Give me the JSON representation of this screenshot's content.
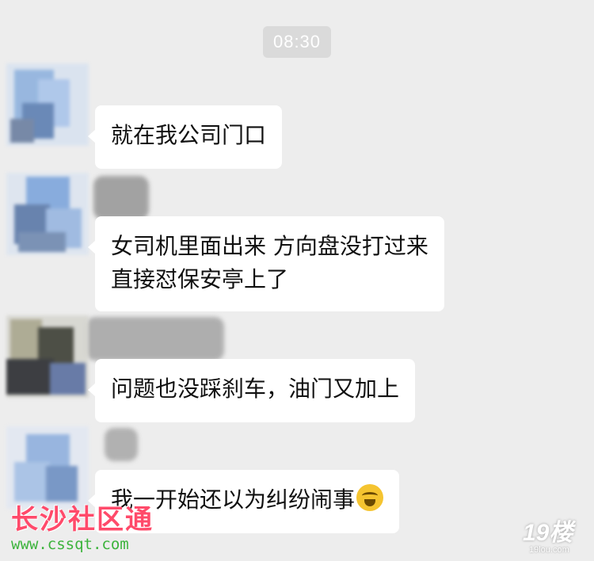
{
  "timestamp": "08:30",
  "messages": [
    {
      "lines": [
        "就在我公司门口"
      ],
      "emoji": ""
    },
    {
      "lines": [
        "女司机里面出来 方向盘没打过来",
        "直接怼保安亭上了"
      ],
      "emoji": ""
    },
    {
      "lines": [
        "问题也没踩刹车，油门又加上"
      ],
      "emoji": ""
    },
    {
      "lines": [
        "我一开始还以为纠纷闹事"
      ],
      "emoji": "face-with-tears-of-joy"
    }
  ],
  "watermarks": {
    "left_title": "长沙社区通",
    "left_url": "www.cssqt.com",
    "right_logo": "19楼",
    "right_sub": "19lou.com"
  }
}
